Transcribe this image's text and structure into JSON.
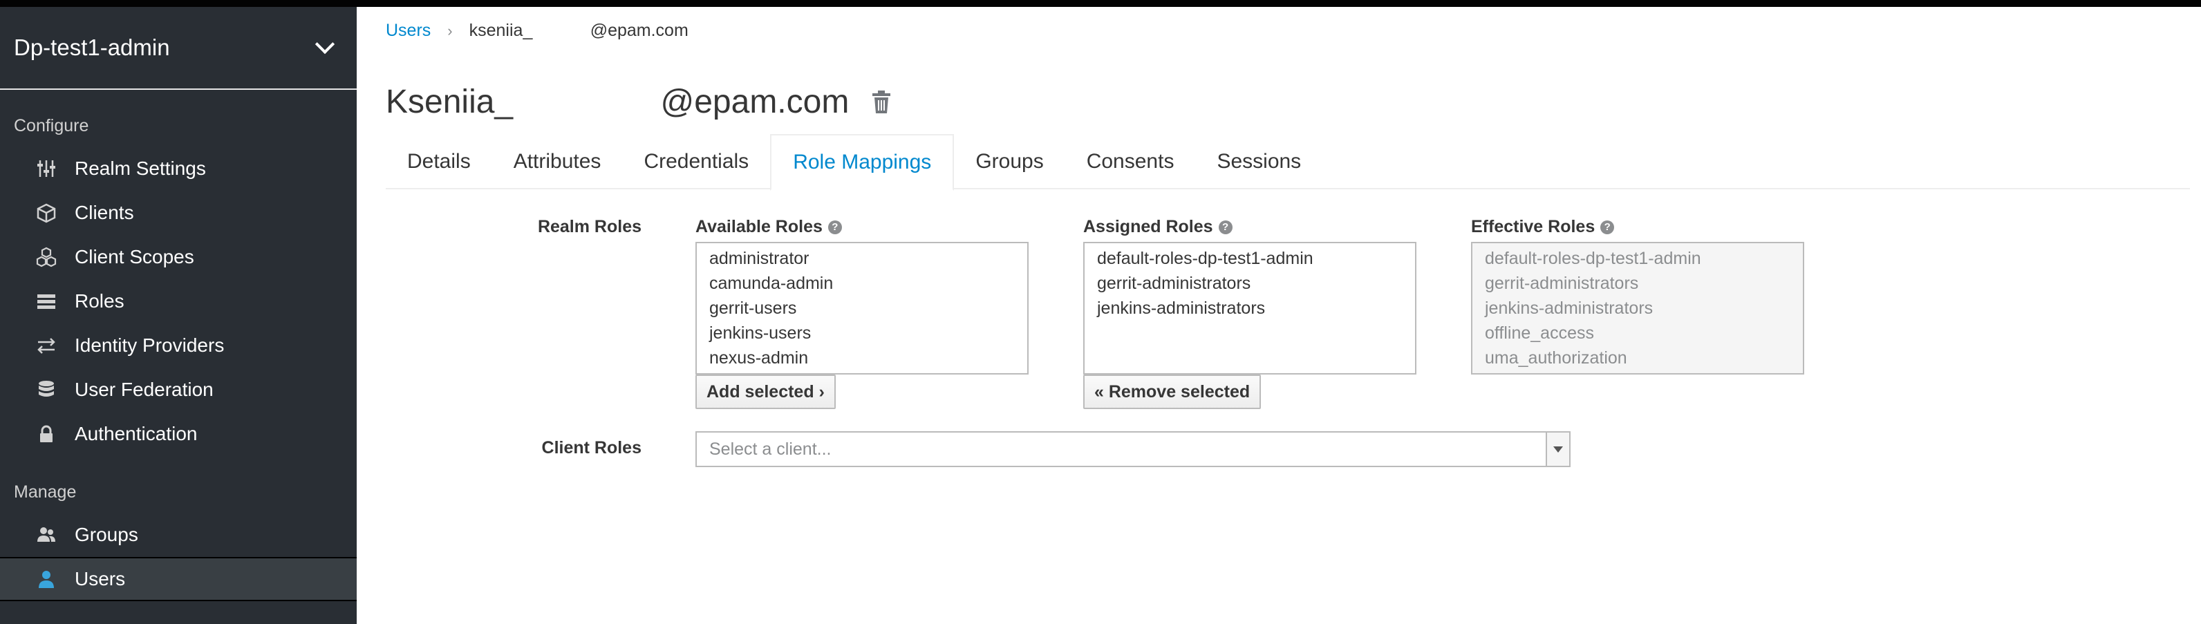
{
  "sidebar": {
    "realm_name": "Dp-test1-admin",
    "configure_label": "Configure",
    "manage_label": "Manage",
    "configure_items": [
      {
        "label": "Realm Settings",
        "icon": "sliders-icon"
      },
      {
        "label": "Clients",
        "icon": "cube-icon"
      },
      {
        "label": "Client Scopes",
        "icon": "cubes-icon"
      },
      {
        "label": "Roles",
        "icon": "list-icon"
      },
      {
        "label": "Identity Providers",
        "icon": "exchange-icon"
      },
      {
        "label": "User Federation",
        "icon": "database-icon"
      },
      {
        "label": "Authentication",
        "icon": "lock-icon"
      }
    ],
    "manage_items": [
      {
        "label": "Groups",
        "icon": "users-icon"
      },
      {
        "label": "Users",
        "icon": "user-icon",
        "active": true
      }
    ]
  },
  "breadcrumb": {
    "root": "Users",
    "current": "kseniia_            @epam.com"
  },
  "page": {
    "title": "Kseniia_                @epam.com"
  },
  "tabs": [
    {
      "label": "Details"
    },
    {
      "label": "Attributes"
    },
    {
      "label": "Credentials"
    },
    {
      "label": "Role Mappings",
      "active": true
    },
    {
      "label": "Groups"
    },
    {
      "label": "Consents"
    },
    {
      "label": "Sessions"
    }
  ],
  "role_mappings": {
    "realm_roles_label": "Realm Roles",
    "client_roles_label": "Client Roles",
    "available_label": "Available Roles",
    "assigned_label": "Assigned Roles",
    "effective_label": "Effective Roles",
    "available": [
      "administrator",
      "camunda-admin",
      "gerrit-users",
      "jenkins-users",
      "nexus-admin"
    ],
    "assigned": [
      "default-roles-dp-test1-admin",
      "gerrit-administrators",
      "jenkins-administrators"
    ],
    "effective": [
      "default-roles-dp-test1-admin",
      "gerrit-administrators",
      "jenkins-administrators",
      "offline_access",
      "uma_authorization"
    ],
    "add_selected": "Add selected ›",
    "remove_selected": "« Remove selected",
    "client_placeholder": "Select a client..."
  },
  "colors": {
    "sidebar_bg": "#292e34",
    "accent": "#0088ce"
  }
}
